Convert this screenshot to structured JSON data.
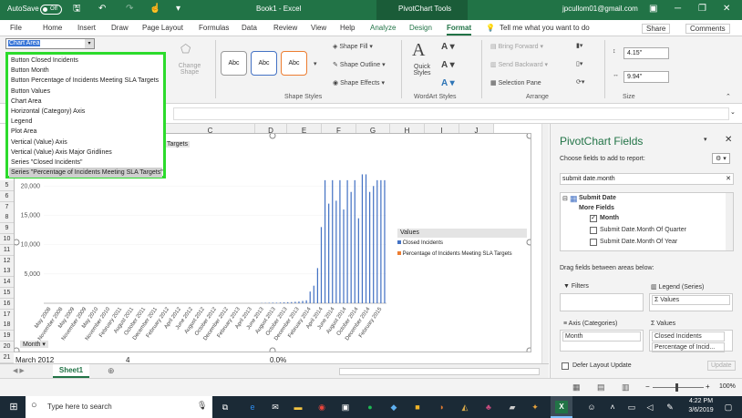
{
  "titlebar": {
    "autosave_label": "AutoSave",
    "autosave_state": "Off",
    "doc_title": "Book1 - Excel",
    "context_tool": "PivotChart Tools",
    "user_email": "jpcullom01@gmail.com"
  },
  "menu": {
    "tabs": [
      "File",
      "Home",
      "Insert",
      "Draw",
      "Page Layout",
      "Formulas",
      "Data",
      "Review",
      "View",
      "Help",
      "Analyze",
      "Design",
      "Format"
    ],
    "tell_me": "Tell me what you want to do",
    "share": "Share",
    "comments": "Comments"
  },
  "ribbon": {
    "chart_element_select": "Chart Area",
    "change_shape": "Change Shape",
    "abc": "Abc",
    "shape_fill": "Shape Fill",
    "shape_outline": "Shape Outline",
    "shape_effects": "Shape Effects",
    "shape_styles_group": "Shape Styles",
    "quick_styles": "Quick Styles",
    "wordart_group": "WordArt Styles",
    "bring_forward": "Bring Forward",
    "send_backward": "Send Backward",
    "selection_pane": "Selection Pane",
    "arrange_group": "Arrange",
    "height": "4.15\"",
    "width": "9.94\"",
    "size_group": "Size"
  },
  "dropdown": {
    "items": [
      "Button Closed Incidents",
      "Button Month",
      "Button Percentage of Incidents Meeting SLA Targets",
      "Button Values",
      "Chart Area",
      "Horizontal (Category) Axis",
      "Legend",
      "Plot Area",
      "Vertical (Value) Axis",
      "Vertical (Value) Axis Major Gridlines",
      "Series \"Closed Incidents\"",
      "Series \"Percentage of Incidents Meeting SLA Targets\""
    ],
    "selected_index": 11
  },
  "grid": {
    "columns": [
      "C",
      "D",
      "E",
      "F",
      "G",
      "H",
      "I",
      "J"
    ],
    "rows": [
      "5",
      "6",
      "7",
      "8",
      "9",
      "10",
      "11",
      "12",
      "13",
      "14",
      "15",
      "16",
      "17",
      "18",
      "19",
      "20",
      "21"
    ],
    "row21": {
      "a": "March 2012",
      "b": "4",
      "c": "0.0%"
    },
    "sheet_tab": "Sheet1"
  },
  "chart_data": {
    "type": "bar",
    "title": "",
    "field_button_label": "Targets",
    "categories": [
      "May 2008",
      "September 2008",
      "January 2009",
      "May 2009",
      "September 2009",
      "January 2010",
      "May 2010",
      "September 2010",
      "January 2011",
      "May 2011",
      "September 2011",
      "January 2012",
      "May 2012",
      "September 2012",
      "January 2013",
      "May 2013",
      "September 2013",
      "January 2014",
      "May 2014",
      "September 2014",
      "January 2015",
      "May 2015"
    ],
    "x_tick_labels": [
      "May 2008",
      "November 2008",
      "May 2009",
      "November 2009",
      "May 2010",
      "November 2010",
      "February 2011",
      "August 2011",
      "October 2011",
      "December 2011",
      "February 2012",
      "April 2012",
      "June 2012",
      "August 2012",
      "October 2012",
      "December 2012",
      "February 2013",
      "April 2013",
      "June 2013",
      "August 2013",
      "October 2013",
      "December 2013",
      "February 2014",
      "April 2014",
      "June 2014",
      "August 2014",
      "October 2014",
      "December 2014",
      "February 2015"
    ],
    "series": [
      {
        "name": "Closed Incidents",
        "color": "#4472c4",
        "values": [
          0,
          0,
          0,
          0,
          0,
          0,
          0,
          0,
          0,
          0,
          0,
          0,
          0,
          0,
          0,
          0,
          0,
          0,
          0,
          0,
          0,
          0,
          0,
          0,
          0,
          0,
          0,
          0,
          0,
          0,
          0,
          0,
          0,
          0,
          0,
          0,
          0,
          0,
          0,
          0,
          0,
          0,
          0,
          0,
          0,
          0,
          0,
          0,
          0,
          0,
          0,
          0,
          0,
          0,
          0,
          0,
          0,
          0,
          50,
          60,
          80,
          100,
          90,
          120,
          150,
          180,
          200,
          250,
          300,
          400,
          500,
          2000,
          3000,
          6000,
          13000,
          21000,
          17000,
          21000,
          17500,
          21000,
          16000,
          21000,
          19000,
          21000,
          14500,
          22000,
          22000,
          19000,
          20000,
          21000,
          21000,
          21000
        ]
      },
      {
        "name": "Percentage of Incidents Meeting SLA Targets",
        "color": "#ed7d31",
        "values": []
      }
    ],
    "yticks": [
      5000,
      10000,
      15000,
      20000
    ],
    "ytick_labels": [
      "5,000",
      "10,000",
      "15,000",
      "20,000"
    ],
    "ylim": [
      0,
      23000
    ],
    "legend_title": "Values",
    "legend_position": "right",
    "axis_button": "Month"
  },
  "pane": {
    "title": "PivotChart Fields",
    "choose": "Choose fields to add to report:",
    "search_value": "submit date.month",
    "tree": {
      "root": "Submit Date",
      "more": "More Fields",
      "month": "Month",
      "quarter": "Submit Date.Month Of Quarter",
      "year": "Submit Date.Month Of Year"
    },
    "drag": "Drag fields between areas below:",
    "filters": "Filters",
    "legend": "Legend (Series)",
    "legend_val": "Values",
    "axis": "Axis (Categories)",
    "axis_val": "Month",
    "values": "Values",
    "values_1": "Closed Incidents",
    "values_2": "Percentage of Incid...",
    "defer": "Defer Layout Update",
    "update": "Update"
  },
  "status": {
    "zoom": "100%"
  },
  "taskbar": {
    "search": "Type here to search",
    "time": "4:22 PM",
    "date": "3/6/2019"
  }
}
